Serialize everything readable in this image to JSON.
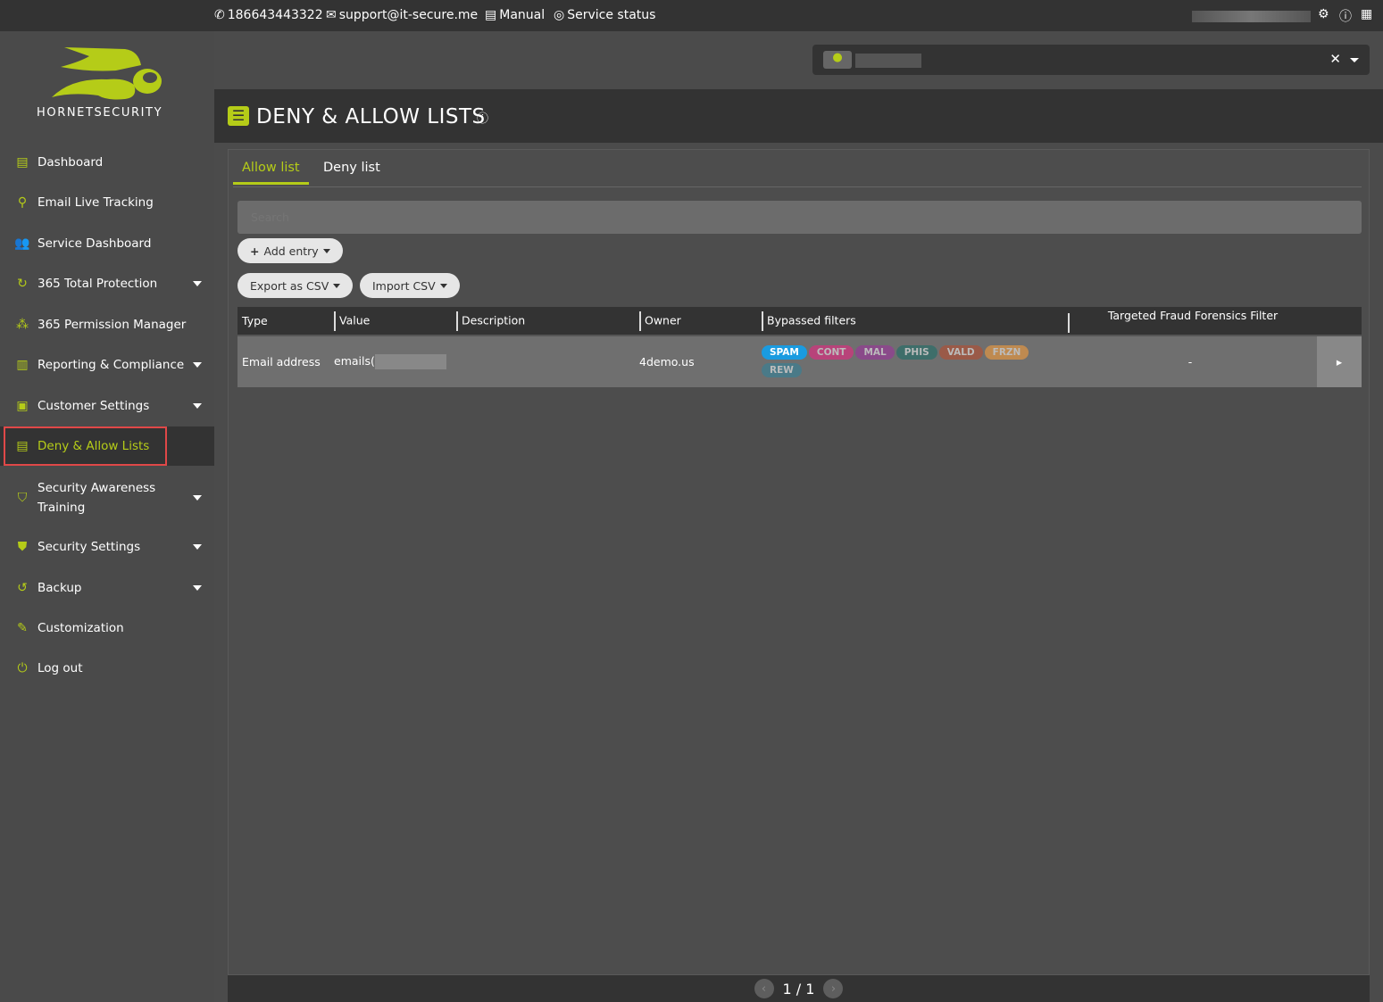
{
  "topbar": {
    "phone": "186643443322",
    "email": "support@it-secure.me",
    "manual": "Manual",
    "service_status": "Service status"
  },
  "brand": {
    "name": "HORNETSECURITY",
    "accent": "#b5cc18"
  },
  "sidebar": {
    "items": [
      {
        "label": "Dashboard",
        "icon": "dashboard-icon"
      },
      {
        "label": "Email Live Tracking",
        "icon": "search-icon"
      },
      {
        "label": "Service Dashboard",
        "icon": "users-icon"
      },
      {
        "label": "365 Total Protection",
        "icon": "refresh-icon",
        "caret": true
      },
      {
        "label": "365 Permission Manager",
        "icon": "network-icon"
      },
      {
        "label": "Reporting & Compliance",
        "icon": "chart-icon",
        "caret": true
      },
      {
        "label": "Customer Settings",
        "icon": "id-card-icon",
        "caret": true
      },
      {
        "label": "Deny & Allow Lists",
        "icon": "list-icon",
        "active": true
      },
      {
        "label": "Security Awareness",
        "label2": "Training",
        "icon": "shield-badge-icon",
        "caret": true
      },
      {
        "label": "Security Settings",
        "icon": "shield-icon",
        "caret": true
      },
      {
        "label": "Backup",
        "icon": "backup-icon",
        "caret": true
      },
      {
        "label": "Customization",
        "icon": "brush-icon"
      },
      {
        "label": "Log out",
        "icon": "power-icon"
      }
    ]
  },
  "header": {
    "title": "DENY & ALLOW LISTS"
  },
  "tabs": [
    {
      "label": "Allow list",
      "active": true
    },
    {
      "label": "Deny list"
    }
  ],
  "search": {
    "placeholder": "Search"
  },
  "buttons": {
    "add_entry": "Add entry",
    "export": "Export as CSV",
    "import": "Import CSV"
  },
  "table": {
    "columns": [
      "Type",
      "Value",
      "Description",
      "Owner",
      "Bypassed filters",
      "Targeted Fraud Forensics Filter"
    ],
    "rows": [
      {
        "type": "Email address",
        "value": "emails(",
        "description": "",
        "owner": "4demo.us",
        "filters": [
          {
            "label": "SPAM",
            "color": "#1a9be0",
            "text": "#fff"
          },
          {
            "label": "CONT",
            "color": "#b8437a"
          },
          {
            "label": "MAL",
            "color": "#8a4a8a"
          },
          {
            "label": "PHIS",
            "color": "#3e6e6a"
          },
          {
            "label": "VALD",
            "color": "#9a5a48"
          },
          {
            "label": "FRZN",
            "color": "#bf8a50"
          },
          {
            "label": "REW",
            "color": "#4a7a88"
          }
        ],
        "tff": "-"
      }
    ]
  },
  "pagination": {
    "text": "1 / 1"
  }
}
